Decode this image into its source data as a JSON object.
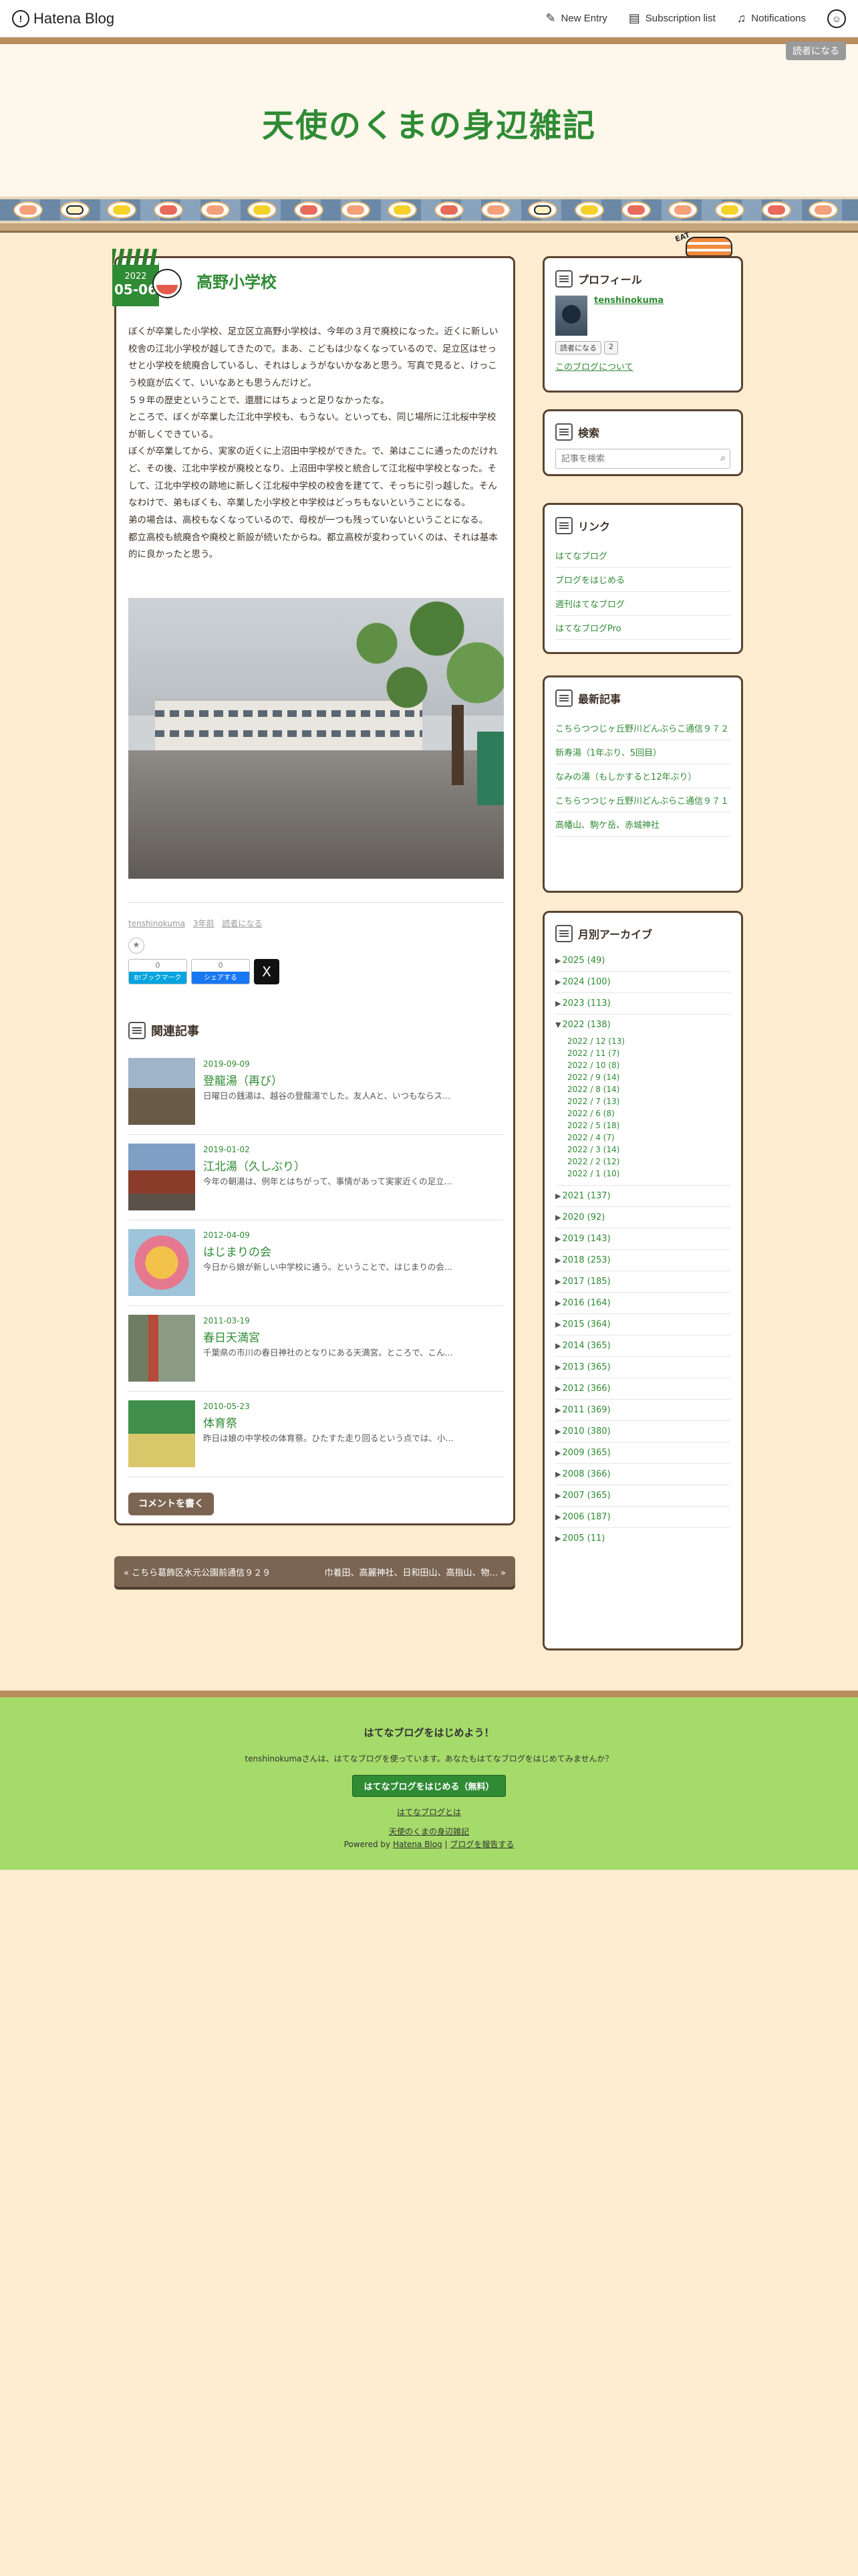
{
  "topbar": {
    "logo": "Hatena Blog",
    "new_entry": "New Entry",
    "subscription_list": "Subscription list",
    "notifications": "Notifications"
  },
  "header": {
    "reader_button": "読者になる",
    "blog_title": "天使のくまの身辺雑記"
  },
  "entry": {
    "date_year": "2022",
    "date_md": "05-06",
    "title": "高野小学校",
    "paragraphs": [
      "ぼくが卒業した小学校、足立区立高野小学校は、今年の３月で廃校になった。近くに新しい校舎の江北小学校が越してきたので。まあ、こどもは少なくなっているので、足立区はせっせと小学校を統廃合しているし、それはしょうがないかなあと思う。写真で見ると、けっこう校庭が広くて、いいなあとも思うんだけど。",
      "５９年の歴史ということで、還暦にはちょっと足りなかったな。",
      "ところで、ぼくが卒業した江北中学校も、もうない。といっても、同じ場所に江北桜中学校が新しくできている。",
      "ぼくが卒業してから、実家の近くに上沼田中学校ができた。で、弟はここに通ったのだけれど、その後、江北中学校が廃校となり、上沼田中学校と統合して江北桜中学校となった。そして、江北中学校の跡地に新しく江北桜中学校の校舎を建てて、そっちに引っ越した。そんなわけで、弟もぼくも、卒業した小学校と中学校はどっちもないということになる。",
      "弟の場合は、高校もなくなっているので、母校が一つも残っていないということになる。",
      "都立高校も統廃合や廃校と新設が続いたからね。都立高校が変わっていくのは、それは基本的に良かったと思う。"
    ],
    "author_meta": "tenshinokuma",
    "meta_time": "3年前",
    "meta_reader": "読者になる",
    "hatena_count": "0",
    "hatena_label": "B!ブックマーク",
    "fb_count": "0",
    "fb_label": "シェアする",
    "x_label": "X",
    "related_heading": "関連記事",
    "related": [
      {
        "date": "2019-09-09",
        "title": "登龍湯（再び）",
        "excerpt": "日曜日の銭湯は、越谷の登龍湯でした。友人Aと、いつもならス..."
      },
      {
        "date": "2019-01-02",
        "title": "江北湯（久しぶり）",
        "excerpt": "今年の朝湯は、例年とはちがって、事情があって実家近くの足立..."
      },
      {
        "date": "2012-04-09",
        "title": "はじまりの会",
        "excerpt": "今日から娘が新しい中学校に通う。ということで、はじまりの会..."
      },
      {
        "date": "2011-03-19",
        "title": "春日天満宮",
        "excerpt": "千葉県の市川の春日神社のとなりにある天満宮。ところで、こん..."
      },
      {
        "date": "2010-05-23",
        "title": "体育祭",
        "excerpt": "昨日は娘の中学校の体育祭。ひたすた走り回るという点では、小..."
      }
    ],
    "comment_button": "コメントを書く"
  },
  "pager": {
    "prev": "« こちら葛飾区水元公園前通信９２９",
    "next": "巾着田、高麗神社、日和田山、高指山、物... »"
  },
  "sidebar": {
    "profile": {
      "heading": "プロフィール",
      "name": "tenshinokuma",
      "reader_button": "読者になる",
      "reader_count": "2",
      "about_link": "このブログについて"
    },
    "search": {
      "heading": "検索",
      "placeholder": "記事を検索"
    },
    "links": {
      "heading": "リンク",
      "items": [
        "はてなブログ",
        "ブログをはじめる",
        "週刊はてなブログ",
        "はてなブログPro"
      ]
    },
    "recent": {
      "heading": "最新記事",
      "items": [
        "こちらつつじヶ丘野川どんぶらこ通信９７２",
        "新寿湯（1年ぶり、5回目）",
        "なみの湯（もしかすると12年ぶり）",
        "こちらつつじヶ丘野川どんぶらこ通信９７１",
        "高幡山、駒ケ岳、赤城神社"
      ]
    },
    "archive": {
      "heading": "月別アーカイブ",
      "years_top": [
        "2025 (49)",
        "2024 (100)",
        "2023 (113)"
      ],
      "open_year": "2022 (138)",
      "months": [
        "2022 / 12 (13)",
        "2022 / 11 (7)",
        "2022 / 10 (8)",
        "2022 / 9 (14)",
        "2022 / 8 (14)",
        "2022 / 7 (13)",
        "2022 / 6 (8)",
        "2022 / 5 (18)",
        "2022 / 4 (7)",
        "2022 / 3 (14)",
        "2022 / 2 (12)",
        "2022 / 1 (10)"
      ],
      "years_bottom": [
        "2021 (137)",
        "2020 (92)",
        "2019 (143)",
        "2018 (253)",
        "2017 (185)",
        "2016 (164)",
        "2015 (364)",
        "2014 (365)",
        "2013 (365)",
        "2012 (366)",
        "2011 (369)",
        "2010 (380)",
        "2009 (365)",
        "2008 (366)",
        "2007 (365)",
        "2006 (187)",
        "2005 (11)"
      ]
    },
    "mascot_text": "EAT"
  },
  "footer": {
    "title": "はてなブログをはじめよう！",
    "desc": "tenshinokumaさんは、はてなブログを使っています。あなたもはてなブログをはじめてみませんか？",
    "start_button": "はてなブログをはじめる（無料）",
    "what_link": "はてなブログとは",
    "blog_link": "天使のくまの身辺雑記",
    "powered_prefix": "Powered by ",
    "powered_link": "Hatena Blog",
    "report_link": "ブログを報告する"
  }
}
